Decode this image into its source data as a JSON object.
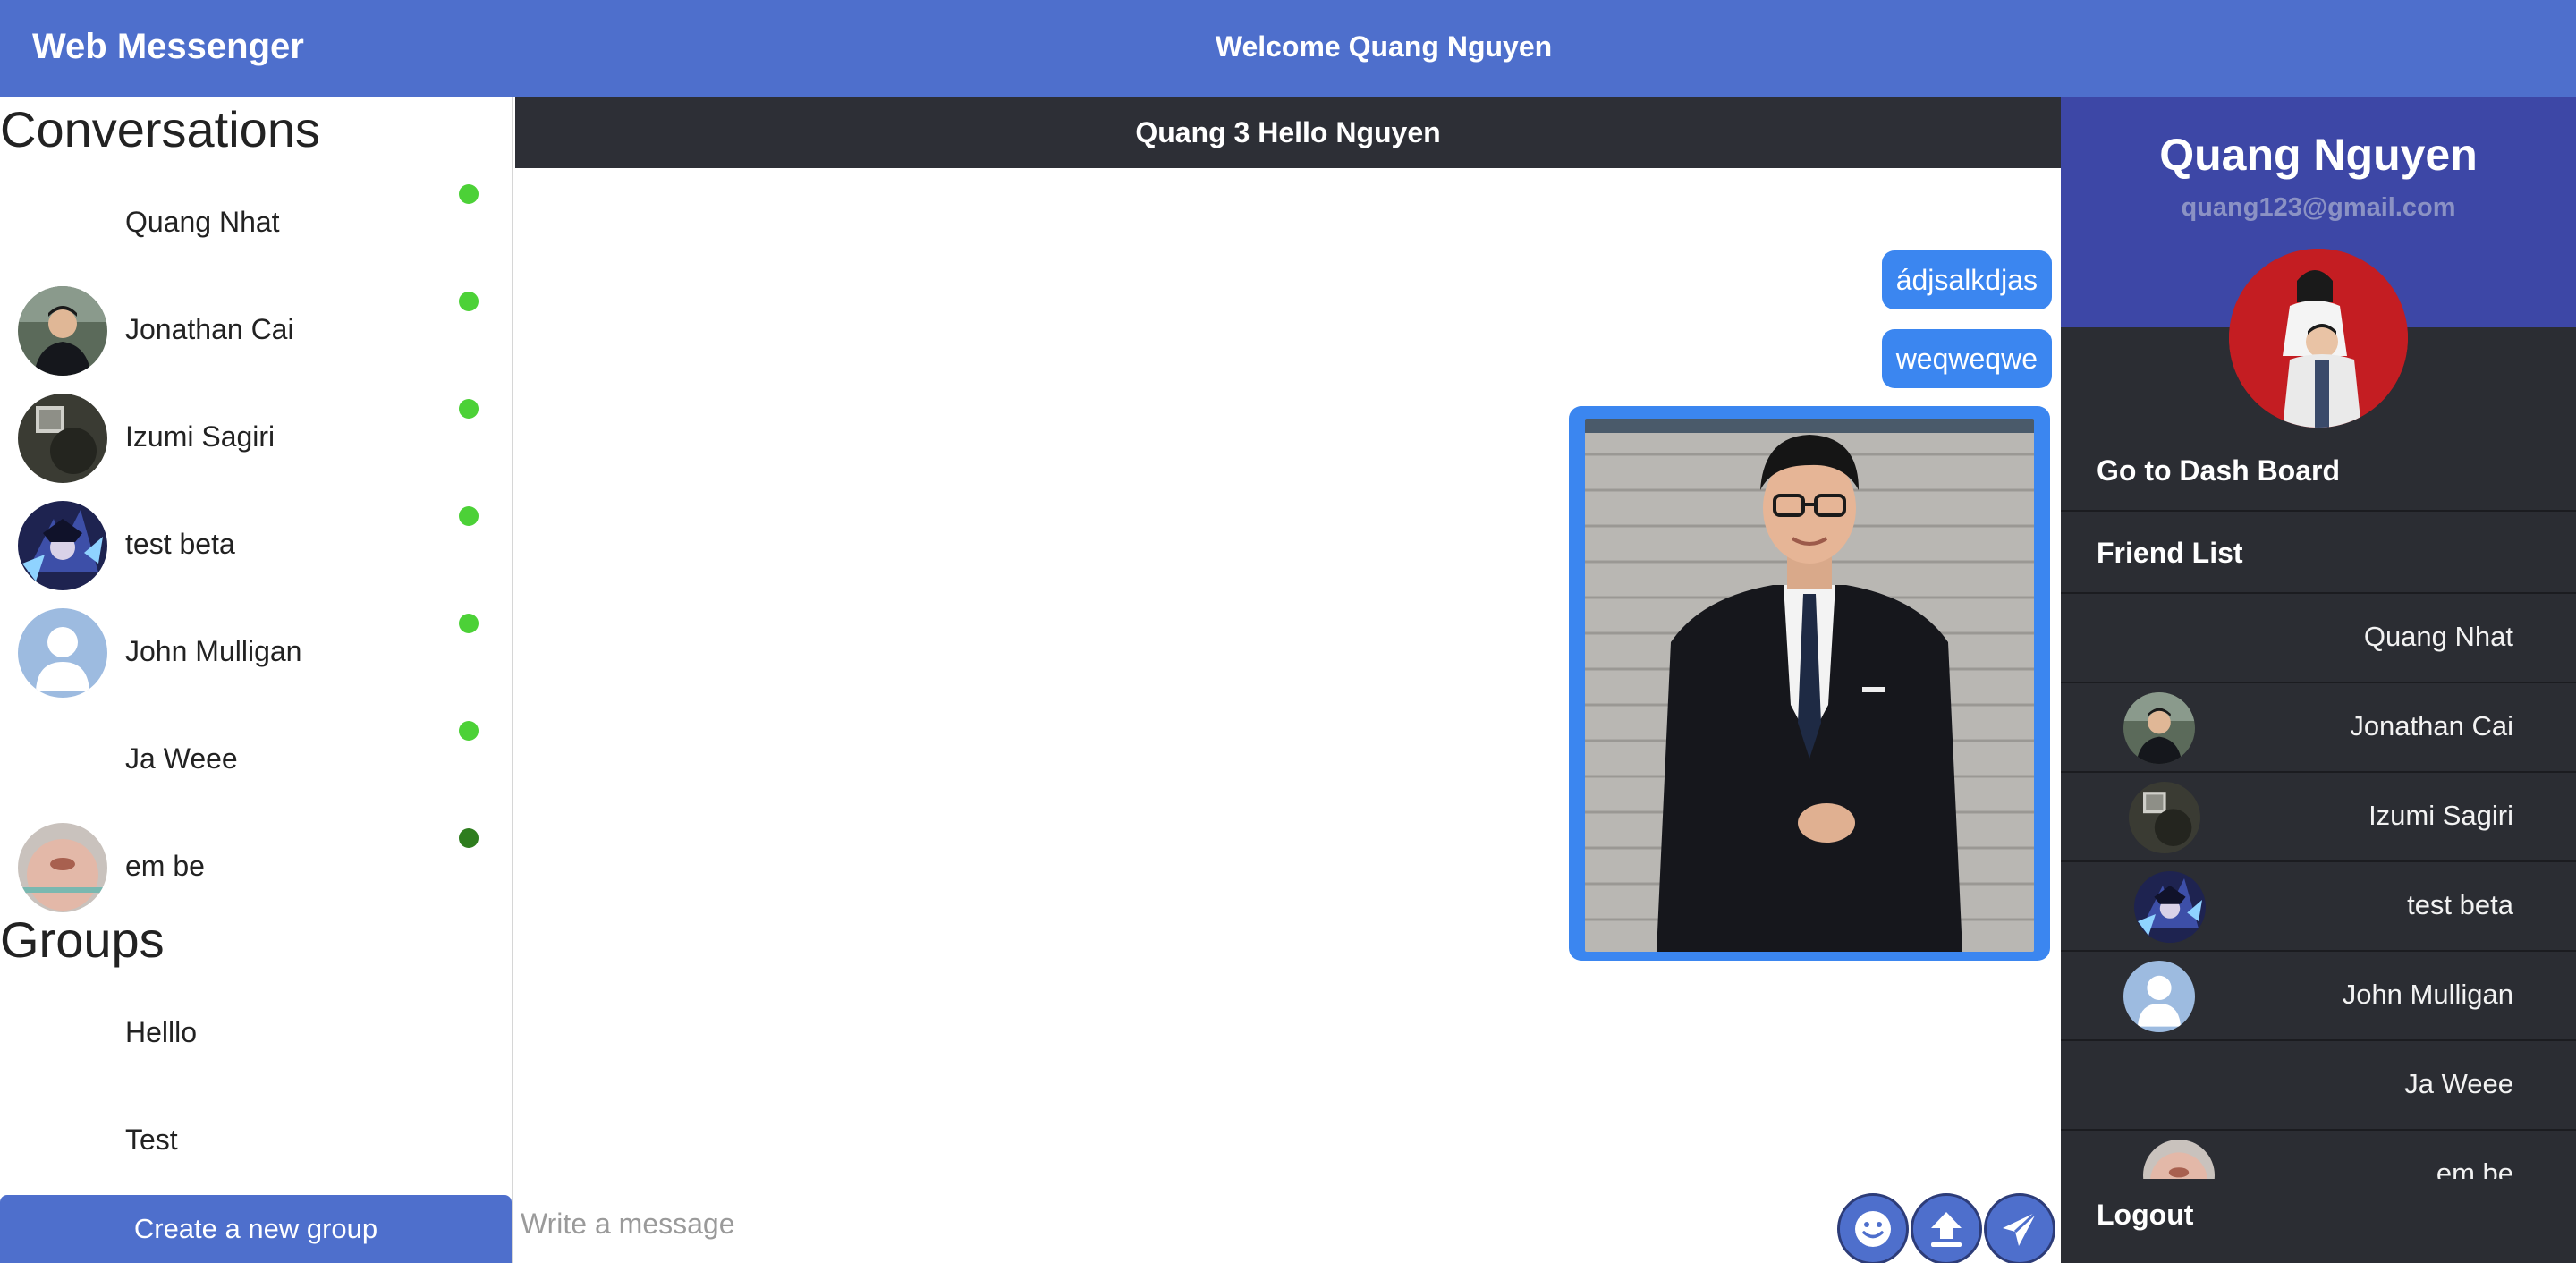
{
  "header": {
    "brand": "Web Messenger",
    "welcome": "Welcome Quang Nguyen"
  },
  "sidebar": {
    "conversations_title": "Conversations",
    "conversations": [
      {
        "name": "Quang Nhat",
        "status": "online",
        "avatar": "blank"
      },
      {
        "name": "Jonathan Cai",
        "status": "online",
        "avatar": "photo-man"
      },
      {
        "name": "Izumi Sagiri",
        "status": "online",
        "avatar": "photo-dark"
      },
      {
        "name": "test beta",
        "status": "online",
        "avatar": "anime"
      },
      {
        "name": "John Mulligan",
        "status": "online",
        "avatar": "default-user"
      },
      {
        "name": "Ja Weee",
        "status": "online",
        "avatar": "blank"
      },
      {
        "name": "em be",
        "status": "away",
        "avatar": "photo-face"
      }
    ],
    "groups_title": "Groups",
    "groups": [
      {
        "name": "Helllo"
      },
      {
        "name": "Test"
      }
    ],
    "create_group_label": "Create a new group"
  },
  "chat": {
    "title": "Quang 3 Hello Nguyen",
    "messages": [
      {
        "type": "text",
        "text": "ádjsalkdjas"
      },
      {
        "type": "text",
        "text": "weqweqwe"
      },
      {
        "type": "image",
        "alt": "man in black suit photo"
      }
    ],
    "composer_placeholder": "Write a message",
    "buttons": {
      "emoji": "emoji-icon",
      "upload": "upload-icon",
      "send": "send-icon"
    }
  },
  "profile": {
    "name": "Quang Nguyen",
    "email": "quang123@gmail.com",
    "dashboard_label": "Go to Dash Board",
    "friend_list_label": "Friend List",
    "friends": [
      {
        "name": "Quang Nhat"
      },
      {
        "name": "Jonathan Cai"
      },
      {
        "name": "Izumi Sagiri"
      },
      {
        "name": "test beta"
      },
      {
        "name": "John Mulligan"
      },
      {
        "name": "Ja Weee"
      },
      {
        "name": "em be"
      }
    ],
    "logout_label": "Logout"
  },
  "colors": {
    "accent": "#4e6fcc",
    "bubble": "#3b86f0",
    "online": "#4cd137",
    "dark_panel": "#2b2d33",
    "profile_bg": "#3d47a6"
  }
}
